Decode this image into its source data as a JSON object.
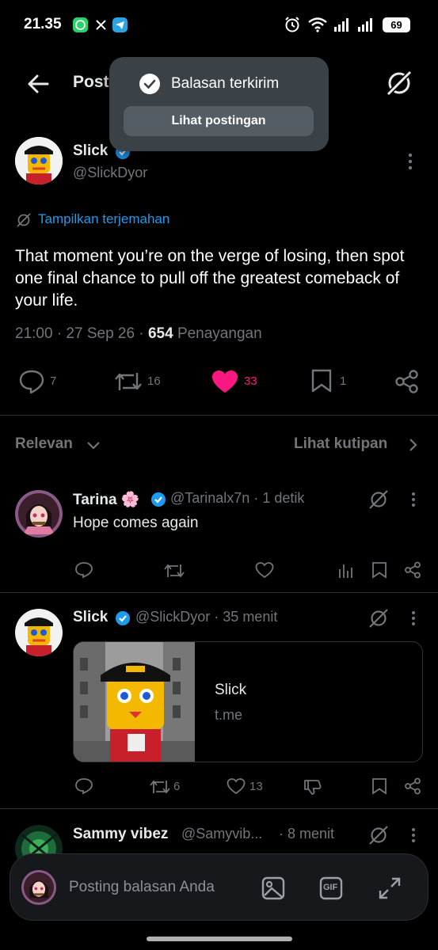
{
  "status_bar": {
    "time": "21.35",
    "battery": "69",
    "apps": [
      "whatsapp-icon",
      "x-icon",
      "telegram-icon"
    ]
  },
  "header": {
    "title": "Posting"
  },
  "toast": {
    "message": "Balasan terkirim",
    "button": "Lihat postingan"
  },
  "main_post": {
    "name": "Slick",
    "handle": "@SlickDyor",
    "translate": "Tampilkan terjemahan",
    "text": "That moment you’re on the verge of losing, then spot one final chance to pull off the greatest comeback of your life.",
    "timestamp": "21:00 · 27 Sep 26 ·",
    "views": "654",
    "views_label": "Penayangan",
    "replies": "7",
    "reposts": "16",
    "likes": "33",
    "bookmarks": "1"
  },
  "sort": {
    "label": "Relevan",
    "quotes": "Lihat kutipan"
  },
  "replies": [
    {
      "name": "Tarina",
      "emoji": "🌸",
      "handle": "@Tarinalx7n",
      "time": "· 1 detik",
      "text": "Hope comes again"
    },
    {
      "name": "Slick",
      "handle": "@SlickDyor",
      "time": "· 35 menit",
      "card_title": "Slick",
      "card_domain": "t.me",
      "reposts": "6",
      "likes": "13"
    },
    {
      "name": "Sammy vibez",
      "handle": "@Samyvib...",
      "time": "· 8 menit"
    }
  ],
  "composer": {
    "placeholder": "Posting balasan Anda",
    "gif": "GIF"
  },
  "colors": {
    "accent": "#1d9bf0",
    "like": "#f91880",
    "muted": "#71767b",
    "background": "#000000"
  }
}
